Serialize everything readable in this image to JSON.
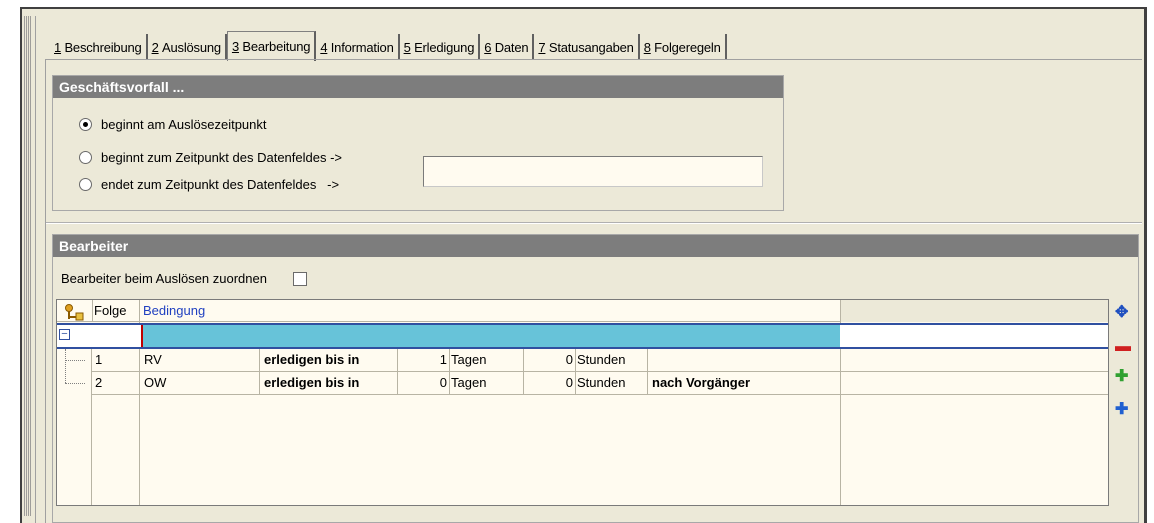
{
  "tabs": [
    {
      "num": "1",
      "label": "Beschreibung"
    },
    {
      "num": "2",
      "label": "Auslösung"
    },
    {
      "num": "3",
      "label": "Bearbeitung",
      "active": true
    },
    {
      "num": "4",
      "label": "Information"
    },
    {
      "num": "5",
      "label": "Erledigung"
    },
    {
      "num": "6",
      "label": "Daten"
    },
    {
      "num": "7",
      "label": "Statusangaben"
    },
    {
      "num": "8",
      "label": "Folgeregeln"
    }
  ],
  "geschaeftsvorfall": {
    "title": "Geschäftsvorfall ...",
    "options": [
      {
        "label": "beginnt am Auslösezeitpunkt",
        "checked": true
      },
      {
        "label": "beginnt zum Zeitpunkt des Datenfeldes ->",
        "checked": false
      },
      {
        "label": "endet zum Zeitpunkt des Datenfeldes   ->",
        "checked": false
      }
    ],
    "datenfeld_value": ""
  },
  "bearbeiter": {
    "title": "Bearbeiter",
    "assign_label": "Bearbeiter beim Auslösen zuordnen",
    "assign_checked": false,
    "grid": {
      "headers": {
        "folge": "Folge",
        "bedingung": "Bedingung"
      },
      "rows": [
        {
          "folge": "1",
          "code": "RV",
          "action": "erledigen bis in",
          "tage": "1",
          "tage_unit": "Tagen",
          "stunden": "0",
          "stunden_unit": "Stunden",
          "extra": ""
        },
        {
          "folge": "2",
          "code": "OW",
          "action": "erledigen bis in",
          "tage": "0",
          "tage_unit": "Tagen",
          "stunden": "0",
          "stunden_unit": "Stunden",
          "extra": "nach Vorgänger"
        }
      ]
    },
    "side_icons": [
      "move-icon",
      "remove-icon",
      "add-icon",
      "add-child-icon"
    ]
  },
  "colors": {
    "header_bg": "#7d7d7d",
    "selected_row": "#67c3d9",
    "field_bg": "#fffbf0",
    "window_bg": "#ece9d8"
  }
}
